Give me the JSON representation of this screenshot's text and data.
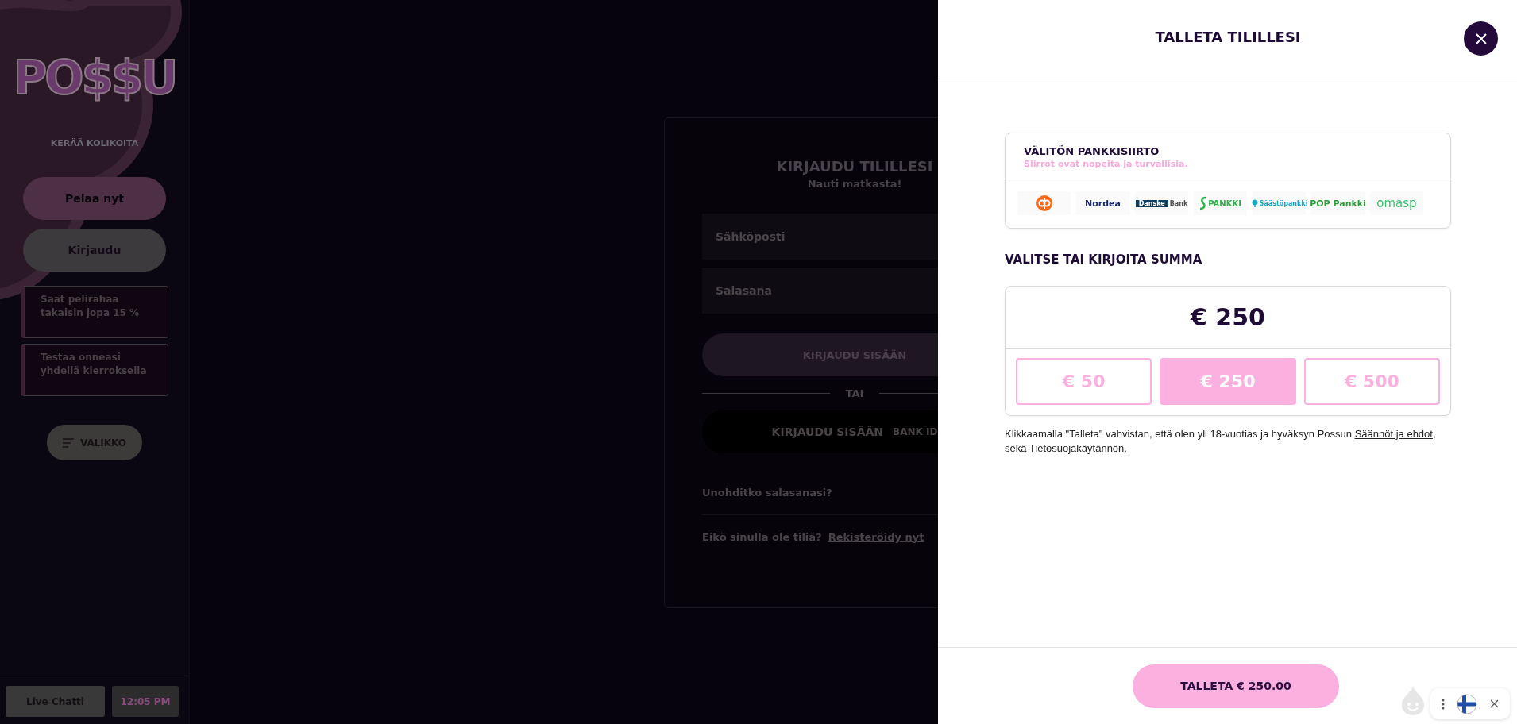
{
  "sidebar": {
    "logo": "PO$$U",
    "tagline": "KERÄÄ KOLIKOITA",
    "buttons": [
      {
        "label": "Pelaa nyt",
        "kind": "primary"
      },
      {
        "label": "Kirjaudu",
        "kind": "secondary"
      }
    ],
    "promos": [
      "Saat pelirahaa takaisin jopa 15 %",
      "Testaa onneasi yhdellä kierroksella"
    ],
    "menu_button": "VALIKKO",
    "footer": {
      "chat_button": "Live Chatti",
      "time": "12:05 PM"
    }
  },
  "login": {
    "title": "KIRJAUDU TILILLESI",
    "subtitle": "Nauti matkasta!",
    "fields": [
      {
        "placeholder": "Sähköposti"
      },
      {
        "placeholder": "Salasana"
      }
    ],
    "submit": "KIRJAUDU SISÄÄN",
    "divider": "TAI",
    "bankid_button": "KIRJAUDU SISÄÄN",
    "bankid_tag": "BANK ID",
    "forgot": "Unohditko salasanasi?",
    "no_account": "Eikö sinulla ole tiliä?",
    "register": "Rekisteröidy nyt"
  },
  "drawer": {
    "title": "TALLETA TILILLESI",
    "bank_transfer": {
      "title": "VÄLITÖN PANKKISIIRTO",
      "subtitle": "Siirrot ovat nopeita ja turvallisia.",
      "banks": [
        {
          "kind": "op",
          "color": "#f26b1d"
        },
        {
          "kind": "word",
          "label": "Nordea",
          "color": "#1a2a6c"
        },
        {
          "kind": "danske",
          "label": "Danske",
          "label2": "Bank",
          "color": "#0f3d5c"
        },
        {
          "kind": "spankki",
          "label": "PANKKI",
          "color": "#2fb04a"
        },
        {
          "kind": "saasto",
          "label": "Säästöpankki",
          "color": "#1aa6c8"
        },
        {
          "kind": "word",
          "label": "POP Pankki",
          "color": "#2e9b3a"
        },
        {
          "kind": "omasp",
          "label": "omasp",
          "color": "#3cbf6a"
        }
      ]
    },
    "amount_heading": "VALITSE TAI KIRJOITA SUMMA",
    "amount_value": "€ 250",
    "presets": [
      {
        "label": "€ 50",
        "selected": false
      },
      {
        "label": "€ 250",
        "selected": true
      },
      {
        "label": "€ 500",
        "selected": false
      }
    ],
    "disclaimer": "Klikkaamalla \"Talleta\" vahvistan, että olen yli 18-vuotias ja hyväksyn Possun ",
    "terms_link": "Säännöt ja ehdot",
    "disclaimer_mid": ", sekä ",
    "privacy_link": "Tietosuojakäytännön",
    "disclaimer_end": ".",
    "deposit_button": "TALLETA € 250.00"
  }
}
